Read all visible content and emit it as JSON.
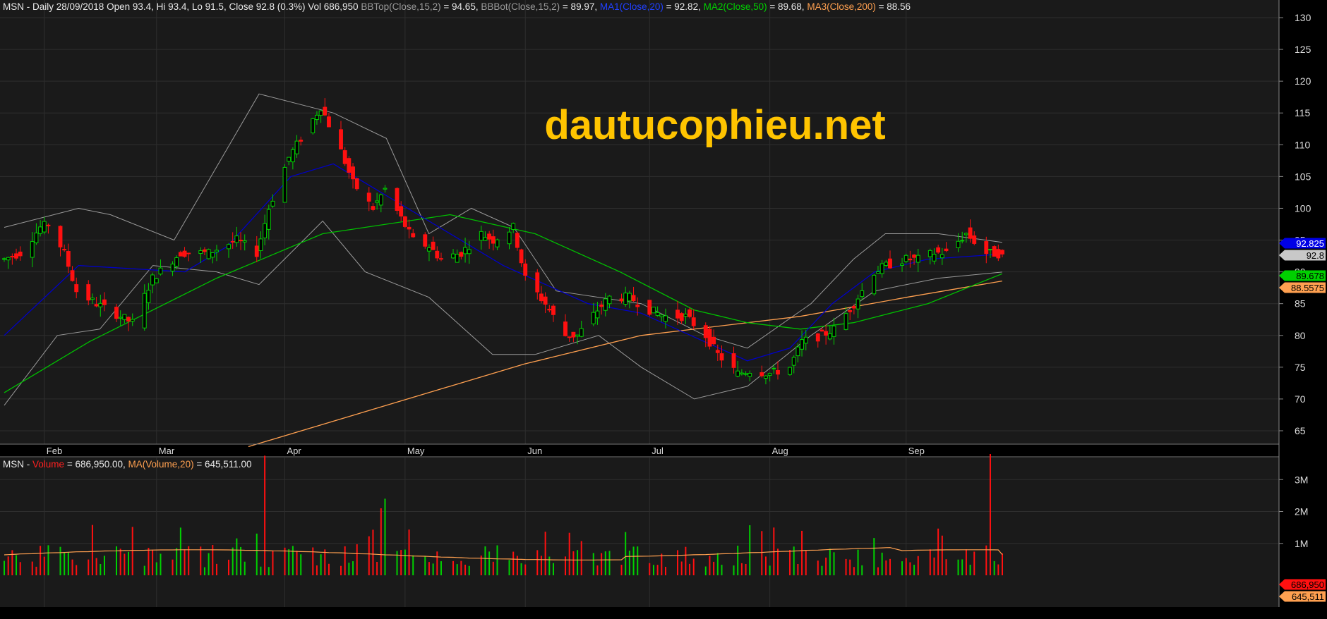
{
  "price_header": {
    "prefix": "MSN - Daily 28/09/2018 Open 93.4, Hi 93.4, Lo 91.5, Close 92.8 (0.3%) Vol 686,950",
    "bbtop_label": "BBTop(Close,15,2)",
    "bbtop_value": "= 94.65,",
    "bbbot_label": "BBBot(Close,15,2)",
    "bbbot_value": "= 89.97,",
    "ma1_label": "MA1(Close,20)",
    "ma1_value": "= 92.82,",
    "ma2_label": "MA2(Close,50)",
    "ma2_value": "= 89.68,",
    "ma3_label": "MA3(Close,200)",
    "ma3_value": "= 88.56"
  },
  "volume_header": {
    "prefix": "MSN -",
    "volume_label": "Volume",
    "volume_value": "= 686,950.00,",
    "ma_label": "MA(Volume,20)",
    "ma_value": "= 645,511.00"
  },
  "watermark": "dautucophieu.net",
  "price_axis_ticks": [
    "130",
    "125",
    "120",
    "115",
    "110",
    "105",
    "100",
    "95",
    "90",
    "85",
    "80",
    "75",
    "70",
    "65"
  ],
  "volume_axis_ticks": [
    "3M",
    "2M",
    "1M"
  ],
  "month_labels": [
    "Feb",
    "Mar",
    "Apr",
    "May",
    "Jun",
    "Jul",
    "Aug",
    "Sep"
  ],
  "price_markers": {
    "ma1": "92.825",
    "close": "92.8",
    "ma2": "89.678",
    "ma3": "88.5575"
  },
  "volume_markers": {
    "volume": "686,950",
    "ma": "645,511"
  },
  "colors": {
    "background": "#000000",
    "panel": "#1a1a1a",
    "up": "#00d000",
    "down": "#ff1010",
    "ma1": "#0000c8",
    "ma2": "#00c000",
    "ma3": "#ffa050",
    "bollinger": "#9a9a9a",
    "watermark": "#ffc400"
  },
  "chart_data": [
    {
      "type": "candlestick",
      "symbol": "MSN",
      "interval": "Daily",
      "last_bar": {
        "date": "28/09/2018",
        "open": 93.4,
        "high": 93.4,
        "low": 91.5,
        "close": 92.8,
        "change_pct": 0.3,
        "volume": 686950
      },
      "ylim": [
        62,
        133
      ],
      "grid": true,
      "x_months": [
        "Feb",
        "Mar",
        "Apr",
        "May",
        "Jun",
        "Jul",
        "Aug",
        "Sep"
      ],
      "ohlc_anchors": [
        [
          "2018-01-22",
          92
        ],
        [
          "2018-01-26",
          93
        ],
        [
          "2018-01-31",
          97
        ],
        [
          "2018-02-02",
          97.5
        ],
        [
          "2018-02-06",
          93
        ],
        [
          "2018-02-09",
          87
        ],
        [
          "2018-02-14",
          85
        ],
        [
          "2018-02-23",
          82
        ],
        [
          "2018-02-28",
          89
        ],
        [
          "2018-03-07",
          93
        ],
        [
          "2018-03-14",
          93
        ],
        [
          "2018-03-21",
          95
        ],
        [
          "2018-03-26",
          93
        ],
        [
          "2018-03-29",
          100
        ],
        [
          "2018-04-03",
          108
        ],
        [
          "2018-04-06",
          111
        ],
        [
          "2018-04-11",
          116
        ],
        [
          "2018-04-16",
          109
        ],
        [
          "2018-04-19",
          104
        ],
        [
          "2018-04-24",
          100
        ],
        [
          "2018-04-27",
          103
        ],
        [
          "2018-05-04",
          95
        ],
        [
          "2018-05-08",
          94
        ],
        [
          "2018-05-11",
          92
        ],
        [
          "2018-05-16",
          93
        ],
        [
          "2018-05-21",
          96
        ],
        [
          "2018-05-24",
          95
        ],
        [
          "2018-05-29",
          97
        ],
        [
          "2018-06-01",
          89
        ],
        [
          "2018-06-06",
          85
        ],
        [
          "2018-06-11",
          80
        ],
        [
          "2018-06-14",
          80
        ],
        [
          "2018-06-19",
          84
        ],
        [
          "2018-06-22",
          86
        ],
        [
          "2018-06-27",
          86
        ],
        [
          "2018-07-02",
          84
        ],
        [
          "2018-07-06",
          83
        ],
        [
          "2018-07-11",
          83
        ],
        [
          "2018-07-16",
          80
        ],
        [
          "2018-07-19",
          77
        ],
        [
          "2018-07-24",
          74
        ],
        [
          "2018-07-27",
          74.5
        ],
        [
          "2018-08-01",
          74
        ],
        [
          "2018-08-06",
          75
        ],
        [
          "2018-08-09",
          79
        ],
        [
          "2018-08-14",
          80
        ],
        [
          "2018-08-17",
          81
        ],
        [
          "2018-08-22",
          85
        ],
        [
          "2018-08-27",
          90
        ],
        [
          "2018-08-30",
          91
        ],
        [
          "2018-09-04",
          92
        ],
        [
          "2018-09-07",
          92
        ],
        [
          "2018-09-11",
          93
        ],
        [
          "2018-09-14",
          93
        ],
        [
          "2018-09-19",
          96
        ],
        [
          "2018-09-24",
          93
        ],
        [
          "2018-09-28",
          92.8
        ]
      ],
      "indicators": {
        "ma1": {
          "name": "MA1(Close,20)",
          "points": [
            [
              0,
              80
            ],
            [
              0.07,
              91
            ],
            [
              0.17,
              90
            ],
            [
              0.21,
              94
            ],
            [
              0.27,
              105
            ],
            [
              0.31,
              107
            ],
            [
              0.4,
              98
            ],
            [
              0.47,
              91
            ],
            [
              0.55,
              85
            ],
            [
              0.6,
              83.5
            ],
            [
              0.66,
              79
            ],
            [
              0.7,
              76
            ],
            [
              0.74,
              78
            ],
            [
              0.78,
              85
            ],
            [
              0.82,
              90
            ],
            [
              0.87,
              92
            ],
            [
              0.94,
              92.8
            ]
          ]
        },
        "ma2": {
          "name": "MA2(Close,50)",
          "points": [
            [
              0,
              71
            ],
            [
              0.08,
              79
            ],
            [
              0.2,
              89
            ],
            [
              0.3,
              96
            ],
            [
              0.42,
              99
            ],
            [
              0.5,
              96
            ],
            [
              0.58,
              90
            ],
            [
              0.65,
              84
            ],
            [
              0.7,
              82
            ],
            [
              0.75,
              81
            ],
            [
              0.8,
              82
            ],
            [
              0.87,
              85
            ],
            [
              0.94,
              89.7
            ]
          ]
        },
        "ma3": {
          "name": "MA3(Close,200)",
          "points": [
            [
              0.23,
              62.5
            ],
            [
              0.35,
              68.5
            ],
            [
              0.49,
              75.5
            ],
            [
              0.6,
              80
            ],
            [
              0.75,
              83
            ],
            [
              0.85,
              86
            ],
            [
              0.94,
              88.5575
            ]
          ]
        },
        "bb_top": {
          "name": "BBTop(Close,15,2)",
          "points": [
            [
              0,
              97
            ],
            [
              0.07,
              100
            ],
            [
              0.1,
              99
            ],
            [
              0.16,
              95
            ],
            [
              0.24,
              118
            ],
            [
              0.31,
              115
            ],
            [
              0.36,
              111
            ],
            [
              0.4,
              96
            ],
            [
              0.44,
              100
            ],
            [
              0.48,
              97
            ],
            [
              0.52,
              87
            ],
            [
              0.6,
              85
            ],
            [
              0.66,
              80
            ],
            [
              0.7,
              78
            ],
            [
              0.76,
              85
            ],
            [
              0.8,
              92
            ],
            [
              0.83,
              96
            ],
            [
              0.88,
              96
            ],
            [
              0.94,
              94.65
            ]
          ]
        },
        "bb_bot": {
          "name": "BBBot(Close,15,2)",
          "points": [
            [
              0,
              69
            ],
            [
              0.05,
              80
            ],
            [
              0.09,
              81
            ],
            [
              0.14,
              91
            ],
            [
              0.2,
              90
            ],
            [
              0.24,
              88
            ],
            [
              0.3,
              98
            ],
            [
              0.34,
              90
            ],
            [
              0.4,
              86
            ],
            [
              0.46,
              77
            ],
            [
              0.5,
              77
            ],
            [
              0.56,
              80
            ],
            [
              0.6,
              75
            ],
            [
              0.65,
              70
            ],
            [
              0.7,
              72
            ],
            [
              0.76,
              80
            ],
            [
              0.82,
              87
            ],
            [
              0.88,
              89
            ],
            [
              0.94,
              89.97
            ]
          ]
        }
      },
      "latest_values": {
        "bbtop": 94.65,
        "bbbot": 89.97,
        "ma1": 92.82,
        "ma2": 89.68,
        "ma3": 88.56
      }
    },
    {
      "type": "bar",
      "series": [
        {
          "name": "Volume"
        },
        {
          "name": "MA(Volume,20)"
        }
      ],
      "ylim": [
        0,
        4000000
      ],
      "last_value": 686950,
      "last_ma": 645511,
      "spikes": [
        {
          "date": "2018-03-28",
          "value": 3750000,
          "color": "down"
        },
        {
          "date": "2018-04-27",
          "value": 2400000,
          "color": "up"
        },
        {
          "date": "2018-04-26",
          "value": 2100000,
          "color": "down"
        },
        {
          "date": "2018-09-25",
          "value": 3800000,
          "color": "down"
        }
      ]
    }
  ]
}
